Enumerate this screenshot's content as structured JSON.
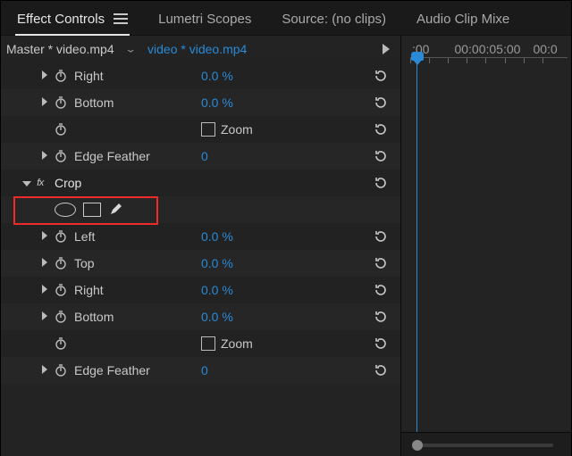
{
  "tabs": {
    "effect_controls": "Effect Controls",
    "lumetri_scopes": "Lumetri Scopes",
    "source": "Source: (no clips)",
    "audio_mixer": "Audio Clip Mixe"
  },
  "clip": {
    "master": "Master * video.mp4",
    "sequence": "video * video.mp4"
  },
  "timecodes": {
    "t0": ":00",
    "t1": "00:00:05:00",
    "t2": "00:0"
  },
  "group1": {
    "right": {
      "label": "Right",
      "value": "0.0 %"
    },
    "bottom": {
      "label": "Bottom",
      "value": "0.0 %"
    },
    "zoom": {
      "label": "Zoom"
    },
    "edge_feather": {
      "label": "Edge Feather",
      "value": "0"
    }
  },
  "crop": {
    "header": "Crop",
    "left": {
      "label": "Left",
      "value": "0.0 %"
    },
    "top": {
      "label": "Top",
      "value": "0.0 %"
    },
    "right": {
      "label": "Right",
      "value": "0.0 %"
    },
    "bottom": {
      "label": "Bottom",
      "value": "0.0 %"
    },
    "zoom": {
      "label": "Zoom"
    },
    "edge_feather": {
      "label": "Edge Feather",
      "value": "0"
    }
  }
}
